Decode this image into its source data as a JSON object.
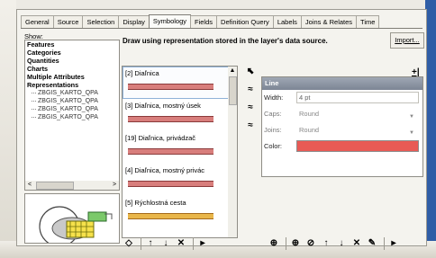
{
  "tabs": [
    "General",
    "Source",
    "Selection",
    "Display",
    "Symbology",
    "Fields",
    "Definition Query",
    "Labels",
    "Joins & Relates",
    "Time"
  ],
  "active_tab": "Symbology",
  "show": {
    "label": "Show:",
    "categories": [
      "Features",
      "Categories",
      "Quantities",
      "Charts",
      "Multiple Attributes",
      "Representations"
    ],
    "sub_items": [
      "ZBGIS_KARTO_QPA",
      "ZBGIS_KARTO_QPA",
      "ZBGIS_KARTO_QPA",
      "ZBGIS_KARTO_QPA"
    ]
  },
  "instruction": "Draw using representation stored in the layer's data source.",
  "import_label": "Import...",
  "representations": [
    {
      "label": "[2] Diaľnica",
      "color": "#d87e7c",
      "stroke": "#8a3a3a"
    },
    {
      "label": "[3] Diaľnica, mostný úsek",
      "color": "#d87e7c",
      "stroke": "#8a3a3a"
    },
    {
      "label": "[19] Diaľnica, privádzač",
      "color": "#d87e7c",
      "stroke": "#8a3a3a"
    },
    {
      "label": "[4] Diaľnica, mostný privác",
      "color": "#d87e7c",
      "stroke": "#8a3a3a"
    },
    {
      "label": "[5] Rýchlostná cesta",
      "color": "#e9b64a",
      "stroke": "#a46a1c"
    }
  ],
  "properties": {
    "header": "Line",
    "width_label": "Width:",
    "width_value": "4 pt",
    "caps_label": "Caps:",
    "caps_value": "Round",
    "joins_label": "Joins:",
    "joins_value": "Round",
    "color_label": "Color:",
    "color_value": "#e85a55",
    "add_label": "+|"
  },
  "toolbar_left": [
    "◇",
    "↑",
    "↓",
    "✕",
    "▸"
  ],
  "toolbar_right": [
    "⊕",
    "⊕",
    "⊘",
    "↑",
    "↓",
    "✕",
    "✎",
    "▸"
  ]
}
